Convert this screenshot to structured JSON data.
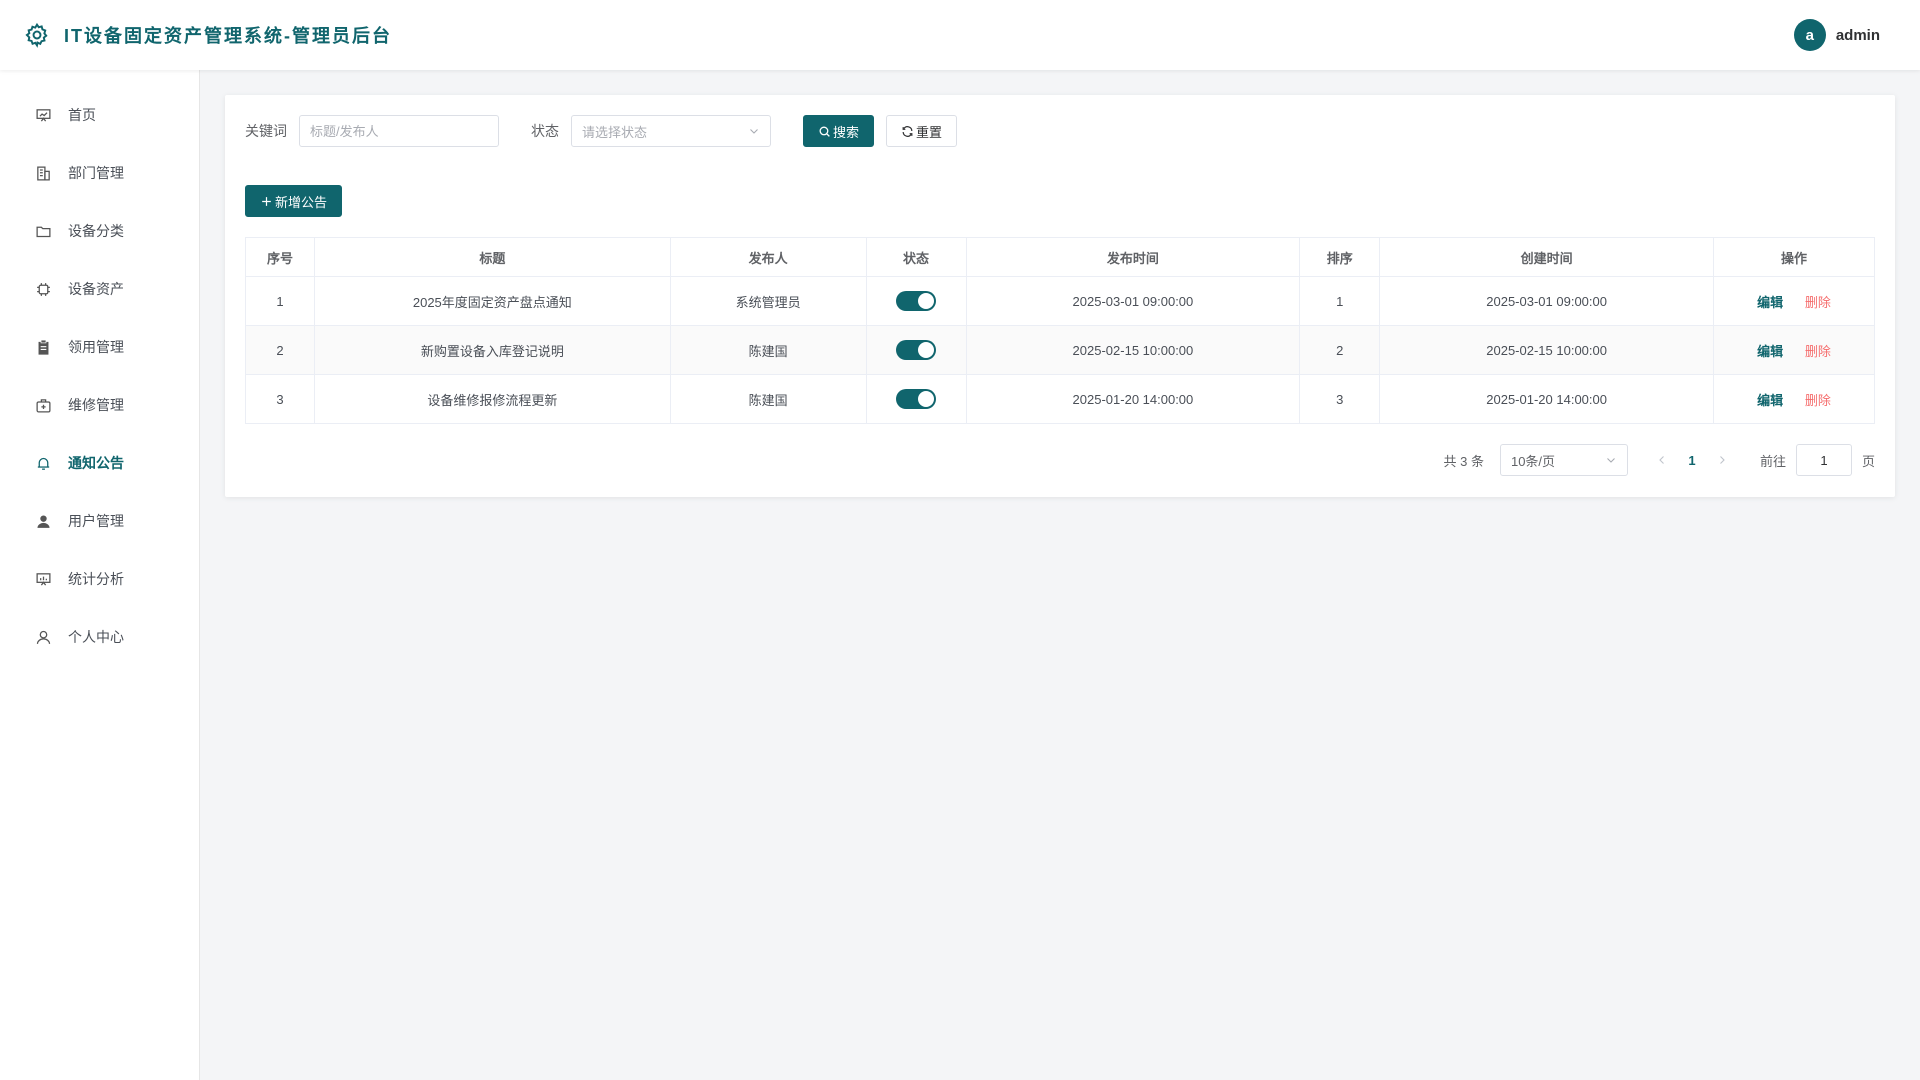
{
  "header": {
    "title": "IT设备固定资产管理系统-管理员后台",
    "avatar_letter": "a",
    "username": "admin"
  },
  "colors": {
    "primary": "#10656d",
    "danger": "#f56c6c"
  },
  "sidebar": {
    "items": [
      {
        "label": "首页",
        "icon": "dashboard-icon"
      },
      {
        "label": "部门管理",
        "icon": "building-icon"
      },
      {
        "label": "设备分类",
        "icon": "folder-icon"
      },
      {
        "label": "设备资产",
        "icon": "chip-icon"
      },
      {
        "label": "领用管理",
        "icon": "clipboard-icon"
      },
      {
        "label": "维修管理",
        "icon": "repair-kit-icon"
      },
      {
        "label": "通知公告",
        "icon": "bell-icon",
        "active": true
      },
      {
        "label": "用户管理",
        "icon": "user-filled-icon"
      },
      {
        "label": "统计分析",
        "icon": "chart-board-icon"
      },
      {
        "label": "个人中心",
        "icon": "user-outline-icon"
      }
    ]
  },
  "search": {
    "keyword_label": "关键词",
    "keyword_placeholder": "标题/发布人",
    "status_label": "状态",
    "status_placeholder": "请选择状态",
    "search_button": "搜索",
    "reset_button": "重置"
  },
  "toolbar": {
    "add_button": "新增公告"
  },
  "table": {
    "columns": [
      "序号",
      "标题",
      "发布人",
      "状态",
      "发布时间",
      "排序",
      "创建时间",
      "操作"
    ],
    "rows": [
      {
        "index": "1",
        "title": "2025年度固定资产盘点通知",
        "publisher": "系统管理员",
        "status_on": true,
        "publish_time": "2025-03-01 09:00:00",
        "sort": "1",
        "created": "2025-03-01 09:00:00"
      },
      {
        "index": "2",
        "title": "新购置设备入库登记说明",
        "publisher": "陈建国",
        "status_on": true,
        "publish_time": "2025-02-15 10:00:00",
        "sort": "2",
        "created": "2025-02-15 10:00:00"
      },
      {
        "index": "3",
        "title": "设备维修报修流程更新",
        "publisher": "陈建国",
        "status_on": true,
        "publish_time": "2025-01-20 14:00:00",
        "sort": "3",
        "created": "2025-01-20 14:00:00"
      }
    ],
    "edit_label": "编辑",
    "delete_label": "删除"
  },
  "pagination": {
    "total": "共 3 条",
    "page_size": "10条/页",
    "current_page": "1",
    "goto_label": "前往",
    "goto_value": "1",
    "goto_suffix": "页"
  }
}
